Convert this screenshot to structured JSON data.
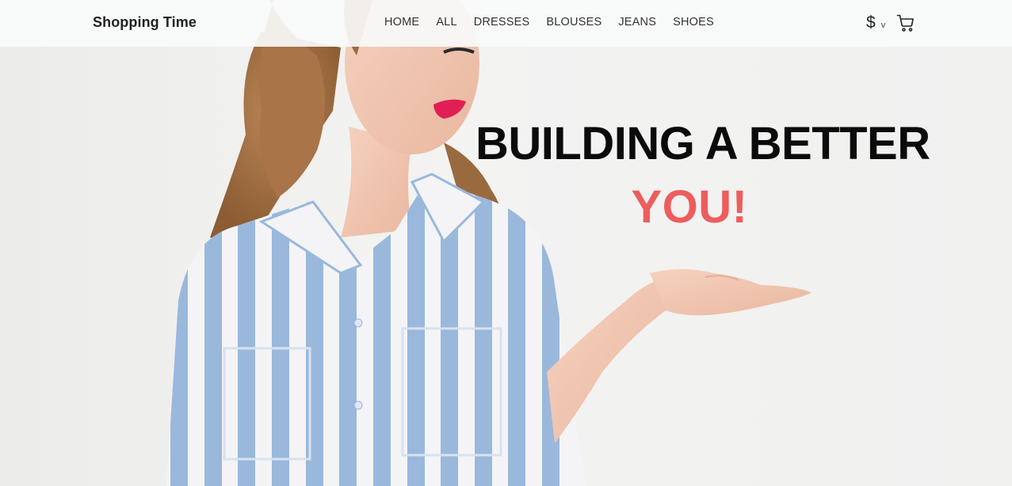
{
  "header": {
    "brand": "Shopping Time",
    "nav": [
      {
        "label": "HOME",
        "icon": null
      },
      {
        "label": "ALL",
        "icon": null
      },
      {
        "label": "DRESSES",
        "icon": null
      },
      {
        "label": "BLOUSES",
        "icon": null
      },
      {
        "label": "JEANS",
        "icon": null
      },
      {
        "label": "SHOES",
        "icon": null
      }
    ],
    "currency": {
      "symbol": "$",
      "caret": "v"
    },
    "cart_icon": "cart-icon"
  },
  "hero": {
    "title": "BUILDING A BETTER",
    "accent": "YOU!",
    "image": "woman-in-striped-shirt-photo"
  },
  "colors": {
    "accent": "#ee5d5d",
    "title": "#0b0b0b",
    "navbar_bg": "#f8fafa",
    "shirt_stripe": "#9ab8dc"
  }
}
